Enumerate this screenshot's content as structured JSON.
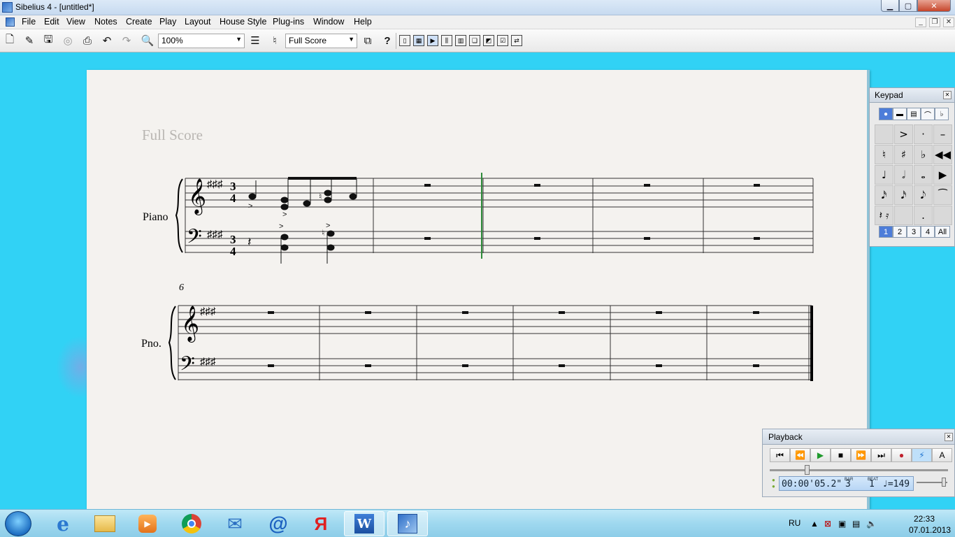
{
  "window": {
    "title": "Sibelius 4 - [untitled*]"
  },
  "menu": [
    "File",
    "Edit",
    "View",
    "Notes",
    "Create",
    "Play",
    "Layout",
    "House Style",
    "Plug-ins",
    "Window",
    "Help"
  ],
  "toolbar": {
    "zoom": "100%",
    "view_select": "Full Score",
    "help_glyph": "?"
  },
  "score": {
    "title": "Full Score",
    "instrument_full": "Piano",
    "instrument_short": "Pno.",
    "time_sig_top": "3",
    "time_sig_bottom": "4",
    "system2_bar_number": "6"
  },
  "keypad": {
    "title": "Keypad",
    "tabs": [
      "●",
      "▬",
      "▤",
      "⌒",
      "♭"
    ],
    "keys": [
      "",
      ">",
      "·",
      "–",
      "♮",
      "♯",
      "♭",
      "◀◀",
      "♩",
      "𝅗𝅥",
      "𝅝",
      "▶",
      "𝅘𝅥𝅯",
      "𝅘𝅥𝅯",
      "𝅘𝅥𝅮",
      "⁀",
      "𝄽 𝄿",
      "",
      ".",
      ""
    ],
    "layouts": [
      "1",
      "2",
      "3",
      "4",
      "All"
    ]
  },
  "playback": {
    "title": "Playback",
    "time": "00:00'05.2\"",
    "bar_label": "BAR",
    "bar": "3",
    "beat_label": "BEAT",
    "beat": "1",
    "tempo": "♩=149",
    "controls": [
      "⏮",
      "⏪",
      "▶",
      "■",
      "⏩",
      "⏭",
      "●",
      "⚡",
      "A"
    ],
    "position_fraction": 0.2,
    "tempo_fraction": 0.9
  },
  "taskbar": {
    "apps": [
      "explorer",
      "internet-explorer",
      "media-player",
      "chrome",
      "mail",
      "mail-ru-agent",
      "yandex-browser",
      "word",
      "sibelius"
    ],
    "lang": "RU",
    "time": "22:33",
    "date": "07.01.2013"
  },
  "colors": {
    "desktop": "#31d2f5",
    "paper": "#f4f2ef",
    "playback_line": "#2e8b3a",
    "keypad_selected": "#4d7dd9"
  }
}
